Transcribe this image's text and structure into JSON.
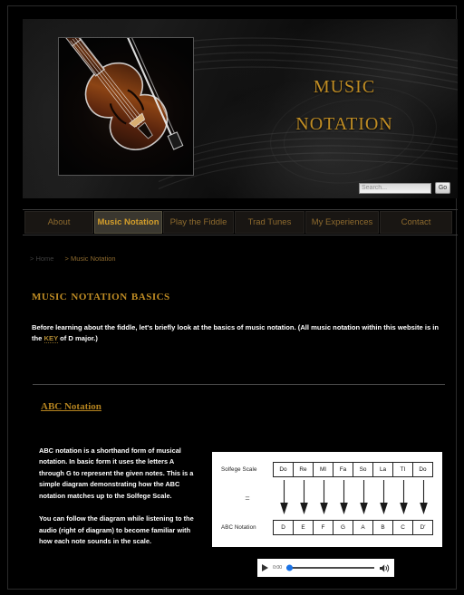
{
  "site": {
    "banner_title_line1": "Music",
    "banner_title_line2": "Notation",
    "accent_gold": "#c08d24",
    "background": "#000000"
  },
  "search": {
    "placeholder": "Search...",
    "value": "",
    "go_label": "Go"
  },
  "nav": {
    "items": [
      {
        "label": "About",
        "active": false
      },
      {
        "label": "Music Notation",
        "active": true
      },
      {
        "label": "Play the Fiddle",
        "active": false
      },
      {
        "label": "Trad Tunes",
        "active": false
      },
      {
        "label": "My Experiences",
        "active": false
      },
      {
        "label": "Contact",
        "active": false
      }
    ]
  },
  "breadcrumb": {
    "home": "> Home",
    "current": "> Music Notation"
  },
  "page": {
    "heading": "Music Notation Basics",
    "intro_before_link": "Before learning about the fiddle, let's briefly look at the basics of music notation. (All music notation within this website is in the ",
    "intro_link": "KEY",
    "intro_after_link": " of D major.)",
    "section_link": "ABC Notation",
    "paragraph_1": "ABC notation is a shorthand form of musical notation. In basic form it uses the letters A through G to represent the given notes. This is a simple diagram demonstrating how the ABC notation matches up to the Solfege Scale.",
    "paragraph_2": "You can follow the diagram while listening to the audio (right of diagram) to become familiar with how each note sounds in the scale."
  },
  "diagram": {
    "row1_label": "Solfege Scale",
    "equals": "=",
    "row2_label": "ABC Notation",
    "solfege": [
      "Do",
      "Re",
      "MI",
      "Fa",
      "So",
      "La",
      "TI",
      "Do"
    ],
    "abc": [
      "D",
      "E",
      "F",
      "G",
      "A",
      "B",
      "C",
      "D′"
    ]
  },
  "audio": {
    "play_icon": "play-icon",
    "time": "0:00",
    "volume_icon": "volume-icon",
    "progress_percent": 0
  }
}
